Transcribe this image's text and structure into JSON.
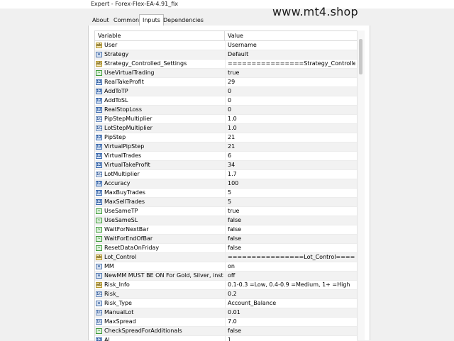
{
  "window": {
    "title": "Expert - Forex-Flex-EA-4.91_fix"
  },
  "watermark": "www.mt4.shop",
  "tabs": [
    {
      "label": "About"
    },
    {
      "label": "Common"
    },
    {
      "label": "Inputs"
    },
    {
      "label": "Dependencies"
    }
  ],
  "grid": {
    "col_variable": "Variable",
    "col_value": "Value",
    "rows": [
      {
        "icon": "ab",
        "name": "User",
        "value": "Username"
      },
      {
        "icon": "enum",
        "name": "Strategy",
        "value": "Default"
      },
      {
        "icon": "ab",
        "name": "Strategy_Controlled_Settings",
        "value": "================Strategy_Controlled_Setti..."
      },
      {
        "icon": "bool",
        "name": "UseVirtualTrading",
        "value": "true"
      },
      {
        "icon": "int",
        "name": "RealTakeProfit",
        "value": "29"
      },
      {
        "icon": "int",
        "name": "AddToTP",
        "value": "0"
      },
      {
        "icon": "int",
        "name": "AddToSL",
        "value": "0"
      },
      {
        "icon": "int",
        "name": "RealStopLoss",
        "value": "0"
      },
      {
        "icon": "dbl",
        "name": "PipStepMultiplier",
        "value": "1.0"
      },
      {
        "icon": "dbl",
        "name": "LotStepMultiplier",
        "value": "1.0"
      },
      {
        "icon": "int",
        "name": "PipStep",
        "value": "21"
      },
      {
        "icon": "int",
        "name": "VirtualPipStep",
        "value": "21"
      },
      {
        "icon": "int",
        "name": "VirtualTrades",
        "value": "6"
      },
      {
        "icon": "int",
        "name": "VirtualTakeProfit",
        "value": "34"
      },
      {
        "icon": "dbl",
        "name": "LotMultiplier",
        "value": "1.7"
      },
      {
        "icon": "int",
        "name": "Accuracy",
        "value": "100"
      },
      {
        "icon": "int",
        "name": "MaxBuyTrades",
        "value": "5"
      },
      {
        "icon": "int",
        "name": "MaxSellTrades",
        "value": "5"
      },
      {
        "icon": "bool",
        "name": "UseSameTP",
        "value": "true"
      },
      {
        "icon": "bool",
        "name": "UseSameSL",
        "value": "false"
      },
      {
        "icon": "bool",
        "name": "WaitForNextBar",
        "value": "false"
      },
      {
        "icon": "bool",
        "name": "WaitForEndOfBar",
        "value": "false"
      },
      {
        "icon": "bool",
        "name": "ResetDataOnFriday",
        "value": "false"
      },
      {
        "icon": "ab",
        "name": "Lot_Control",
        "value": "================Lot_Control========..."
      },
      {
        "icon": "enum",
        "name": "MM",
        "value": "on"
      },
      {
        "icon": "enum",
        "name": "NewMM MUST BE ON For Gold, Silver, instr...",
        "value": "off"
      },
      {
        "icon": "ab",
        "name": "Risk_Info",
        "value": "0.1-0.3 =Low, 0.4-0.9 =Medium, 1+ =High"
      },
      {
        "icon": "dbl",
        "name": "Risk_",
        "value": "0.2"
      },
      {
        "icon": "enum",
        "name": "Risk_Type",
        "value": "Account_Balance"
      },
      {
        "icon": "dbl",
        "name": "ManualLot",
        "value": "0.01"
      },
      {
        "icon": "dbl",
        "name": "MaxSpread",
        "value": "7.0"
      },
      {
        "icon": "bool",
        "name": "CheckSpreadForAdditionals",
        "value": "false"
      },
      {
        "icon": "int",
        "name": "Al...",
        "value": "1"
      }
    ]
  },
  "icon_labels": {
    "ab": "ab",
    "int": "123",
    "dbl": "1/2",
    "bool": "~",
    "enum": "≡"
  },
  "colors": {
    "alt_row": "#f2f2f2",
    "border": "#d8d8d8"
  }
}
